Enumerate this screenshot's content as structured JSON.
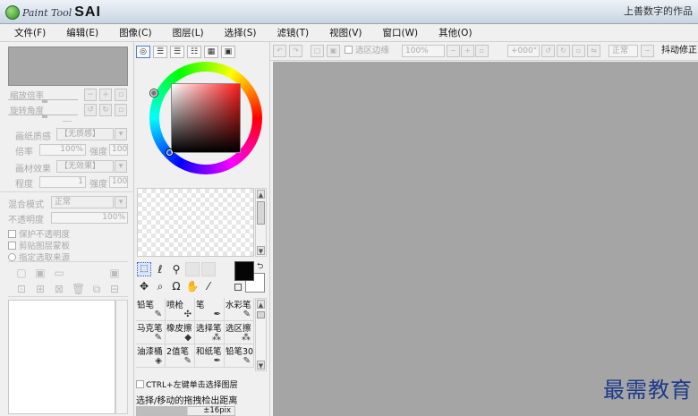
{
  "titlebar": {
    "app_prefix": "Paint Tool",
    "app_name": "SAI",
    "right_text": "上善数字的作品"
  },
  "menu": [
    "文件(F)",
    "编辑(E)",
    "图像(C)",
    "图层(L)",
    "选择(S)",
    "滤镜(T)",
    "视图(V)",
    "窗口(W)",
    "其他(O)"
  ],
  "left_panel": {
    "zoom_label": "缩放倍率",
    "rotate_label": "旋转角度",
    "paper_texture_label": "画纸质感",
    "paper_texture_value": "【无质感】",
    "scale_label": "倍率",
    "scale_value": "100%",
    "strength_label_1": "强度",
    "strength_value_1": "100",
    "effect_label": "画材效果",
    "effect_value": "【无效果】",
    "degree_label": "程度",
    "degree_value": "1",
    "strength_label_2": "强度",
    "strength_value_2": "100",
    "blend_label": "混合模式",
    "blend_value": "正常",
    "opacity_label": "不透明度",
    "opacity_value": "100%",
    "protect_opacity": "保护不透明度",
    "clip_group": "剪贴图层蒙板",
    "selection_source": "指定选取来源"
  },
  "tool_panel": {
    "fg_color": "#050505",
    "bg_color": "#ffffff",
    "brushes": [
      "铅笔",
      "喷枪",
      "笔",
      "水彩笔",
      "马克笔",
      "橡皮擦",
      "选择笔",
      "选区擦",
      "油漆桶",
      "2值笔",
      "和纸笔",
      "铅笔30"
    ],
    "ctrl_option": "CTRL+左键单击选择图层",
    "select_move_label": "选择/移动的拖拽检出距离",
    "distance_value": "±16pix",
    "distance_fill": 0.52
  },
  "canvas_toolbar": {
    "selection_edge": "选区边缘",
    "zoom": "100%",
    "angle": "+000°",
    "mode": "正常",
    "stabilizer": "抖动修正"
  },
  "watermark": "最需教育"
}
